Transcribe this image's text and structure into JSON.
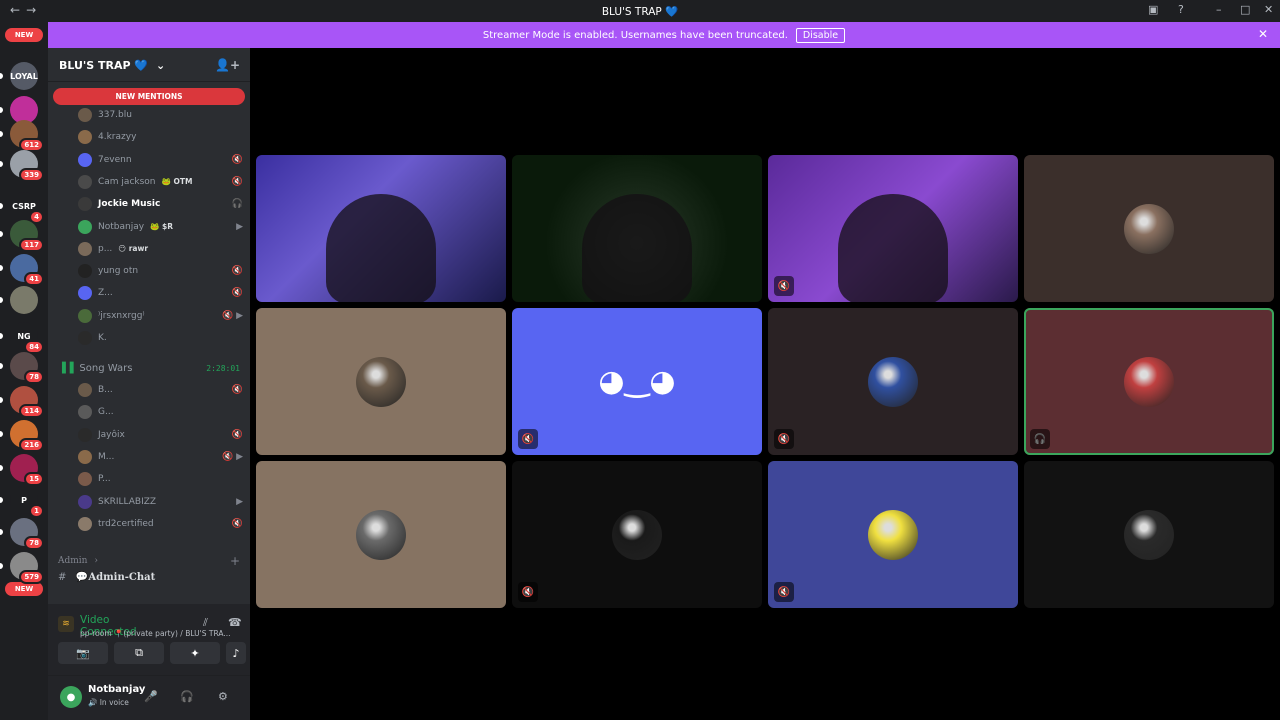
{
  "titlebar": {
    "title": "BLU'S TRAP 💙",
    "back": "←",
    "forward": "→",
    "inbox": "▣",
    "help": "?",
    "minimize": "–",
    "maximize": "□",
    "close": "✕"
  },
  "banner": {
    "message": "Streamer Mode is enabled. Usernames have been truncated.",
    "button": "Disable",
    "close": "✕"
  },
  "rail": {
    "new_top": "NEW",
    "new_bottom": "NEW",
    "servers": [
      {
        "label": "LOYAL",
        "color": "#555a66",
        "badge": ""
      },
      {
        "label": "",
        "color": "#c02f9a",
        "badge": ""
      },
      {
        "label": "",
        "color": "#8a5a3a",
        "badge": "612"
      },
      {
        "label": "",
        "color": "#9aa0a8",
        "badge": "339"
      },
      {
        "label": "CSRP",
        "color": "#1e1f22",
        "badge": "4"
      },
      {
        "label": "",
        "color": "#3a5a3a",
        "badge": "117"
      },
      {
        "label": "",
        "color": "#4a6aa0",
        "badge": "41"
      },
      {
        "label": "",
        "color": "#7a7a6a",
        "badge": ""
      },
      {
        "label": "NG",
        "color": "#1e1f22",
        "badge": "84"
      },
      {
        "label": "",
        "color": "#5a4a4a",
        "badge": "78"
      },
      {
        "label": "",
        "color": "#b05040",
        "badge": "114"
      },
      {
        "label": "",
        "color": "#d07030",
        "badge": "216"
      },
      {
        "label": "",
        "color": "#a02050",
        "badge": "15"
      },
      {
        "label": "P",
        "color": "#1e1f22",
        "badge": "1"
      },
      {
        "label": "",
        "color": "#6a7080",
        "badge": "78"
      },
      {
        "label": "",
        "color": "#8a8a8a",
        "badge": "579"
      }
    ]
  },
  "sidebar": {
    "guild_name": "BLU'S TRAP 💙",
    "guild_chevron": "⌄",
    "invite_icon": "👤+",
    "new_mentions": "NEW MENTIONS",
    "members": [
      {
        "name": "337.blu",
        "tag": "",
        "icons": "",
        "color": "#6a5a4a"
      },
      {
        "name": "4.krazyy",
        "tag": "",
        "icons": "",
        "color": "#8a6a4a"
      },
      {
        "name": "7evenn",
        "tag": "",
        "icons": "🔇",
        "color": "#5865f2"
      },
      {
        "name": "Cam jackson",
        "tag": "🐸 OTM",
        "icons": "🔇",
        "color": "#4a4a4a"
      },
      {
        "name": "Jockie Music",
        "tag": "",
        "icons": "🎧",
        "color": "#3a3a3a",
        "hi": true
      },
      {
        "name": "Notbanjay",
        "tag": "🐸 $R",
        "icons": "▶",
        "color": "#3ba55c"
      },
      {
        "name": "p...",
        "tag": "😶 rawr",
        "icons": "",
        "color": "#7a6a5a"
      },
      {
        "name": "yung otn",
        "tag": "",
        "icons": "🔇",
        "color": "#222"
      },
      {
        "name": "Z...",
        "tag": "",
        "icons": "🔇",
        "color": "#5865f2"
      },
      {
        "name": "⁾jrsxnxrgg⁾",
        "tag": "",
        "icons": "🔇 ▶",
        "color": "#4a6a3a"
      },
      {
        "name": "K.",
        "tag": "",
        "icons": "",
        "color": "#2a2a2a"
      }
    ],
    "channel": {
      "name": "Song Wars",
      "timer": "2:28:01"
    },
    "channel_members": [
      {
        "name": "B...",
        "icons": "🔇",
        "color": "#6a5a4a"
      },
      {
        "name": "G...",
        "icons": "",
        "color": "#5a5a5a"
      },
      {
        "name": "Jayôix",
        "icons": "🔇",
        "color": "#2a2a2a"
      },
      {
        "name": "M...",
        "icons": "🔇 ▶",
        "color": "#8a6a4a"
      },
      {
        "name": "P...",
        "icons": "",
        "color": "#7a5a4a"
      },
      {
        "name": "SKRILLABIZZ",
        "icons": "▶",
        "color": "#4a3a8a"
      },
      {
        "name": "trd2certified",
        "icons": "🔇",
        "color": "#8a7a6a"
      }
    ],
    "category": "Admin",
    "category_chevron": "›",
    "category_add": "+",
    "admin_channel": "💬𝐀𝐝𝐦𝐢𝐧-𝐂𝐡𝐚𝐭"
  },
  "voice": {
    "title": "Video Connected",
    "subtitle": "pp-room 📍(private party) / BLU'S TRA...",
    "camera": "📷",
    "share": "⧉",
    "activity": "✦",
    "soundboard": "♪"
  },
  "user": {
    "name": "Notbanjay",
    "status": "🔊 In voice",
    "mic": "🎤",
    "headset": "🎧",
    "settings": "⚙"
  },
  "tiles": [
    {
      "kind": "video",
      "bg": "linear-gradient(135deg,#3a2fa0,#6a5acd 40%,#1a1a4a)",
      "mute": ""
    },
    {
      "kind": "video",
      "bg": "radial-gradient(circle at 50% 60%,#2a3a2a,#0a1a0a 60%),#0a0a0a",
      "mute": ""
    },
    {
      "kind": "video",
      "bg": "linear-gradient(135deg,#5a2a9a,#8a4ad0 50%,#2a1a4a)",
      "mute": "🔇"
    },
    {
      "kind": "avatar",
      "bg": "#3b2f2b",
      "av": "#8a7060",
      "mute": ""
    },
    {
      "kind": "avatar",
      "bg": "#867362",
      "av": "#6a5a4a",
      "mute": ""
    },
    {
      "kind": "avatar",
      "bg": "#5865f2",
      "av": "discord",
      "mute": "🔇"
    },
    {
      "kind": "avatar",
      "bg": "#2a2224",
      "av": "#3050a0",
      "mute": "🔇"
    },
    {
      "kind": "avatar",
      "bg": "#5c2e32",
      "av": "#c04040",
      "mute": "🎧",
      "speaking": true
    },
    {
      "kind": "avatar",
      "bg": "#867362",
      "av": "#6a6a6a",
      "mute": ""
    },
    {
      "kind": "avatar",
      "bg": "#0e0e0e",
      "av": "#1a1a1a",
      "mute": "🔇"
    },
    {
      "kind": "avatar",
      "bg": "#3f4799",
      "av": "#f0e040",
      "mute": "🔇"
    },
    {
      "kind": "avatar",
      "bg": "#121212",
      "av": "#2a2a2a",
      "mute": ""
    }
  ]
}
